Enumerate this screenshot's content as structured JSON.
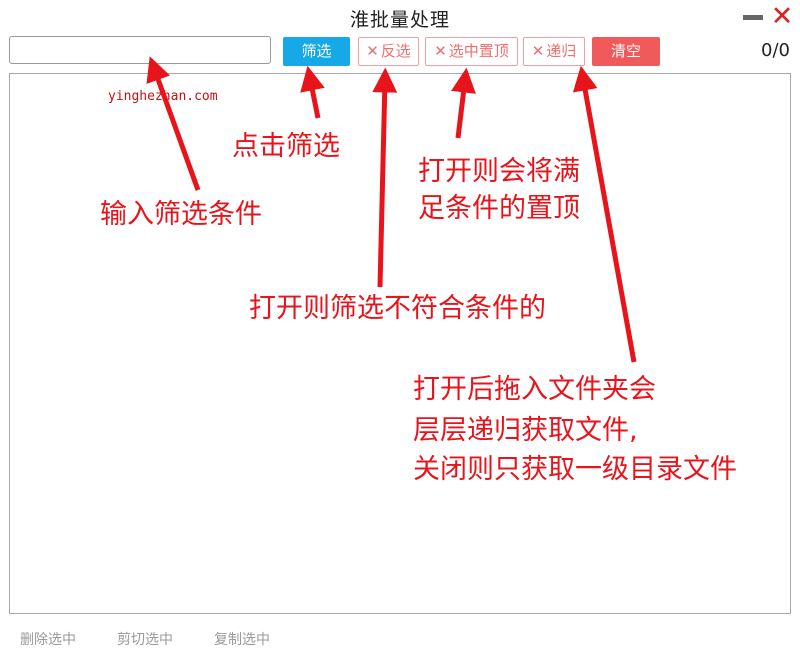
{
  "window": {
    "title": "淮批量处理"
  },
  "toolbar": {
    "filter_input_value": "",
    "filter_label": "筛选",
    "invert_label": "反选",
    "top_label": "选中置顶",
    "recursive_label": "递归",
    "clear_label": "清空",
    "toggle_mark": "✕",
    "counter": "0/0"
  },
  "bottom": {
    "delete_selected": "删除选中",
    "cut_selected": "剪切选中",
    "copy_selected": "复制选中"
  },
  "annotations": {
    "watermark": "yinghezhan.com",
    "click_filter": "点击筛选",
    "enter_condition": "输入筛选条件",
    "top_line1": "打开则会将满",
    "top_line2": "足条件的置顶",
    "invert_desc": "打开则筛选不符合条件的",
    "recur_line1": "打开后拖入文件夹会",
    "recur_line2": "层层递归获取文件,",
    "recur_line3": "关闭则只获取一级目录文件"
  },
  "colors": {
    "filter_button": "#16a9e8",
    "clear_button": "#f05a5a",
    "toggle_text": "#f07070",
    "annotation": "#e8141c",
    "close_icon": "#e02020"
  }
}
